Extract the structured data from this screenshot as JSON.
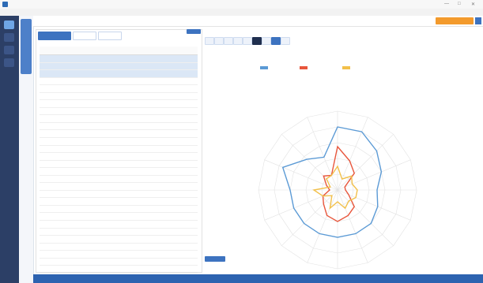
{
  "window": {
    "title": "",
    "controls": [
      "—",
      "□",
      "✕"
    ]
  },
  "menu": {
    "items": [
      "",
      "",
      "",
      ""
    ]
  },
  "header": {
    "breadcrumb": "",
    "action_button": ""
  },
  "left": {
    "tabs": [
      "",
      "",
      ""
    ],
    "columns": [
      "",
      "",
      "",
      "",
      "",
      "",
      ""
    ],
    "rows": [
      {
        "name": "",
        "cells": [
          "",
          "",
          "",
          "",
          "",
          ""
        ],
        "selected": true
      },
      {
        "name": "",
        "cells": [
          "",
          "",
          "",
          "",
          "",
          ""
        ],
        "selected": true
      },
      {
        "name": "",
        "cells": [
          "",
          "",
          "",
          "",
          "",
          ""
        ],
        "selected": true
      },
      {
        "name": "",
        "cells": [
          "",
          "",
          "",
          "",
          "",
          ""
        ]
      },
      {
        "name": "",
        "cells": [
          "",
          "",
          "",
          "",
          "",
          ""
        ]
      },
      {
        "name": "",
        "cells": [
          "",
          "",
          "",
          "",
          "",
          ""
        ]
      },
      {
        "name": "",
        "cells": [
          "",
          "",
          "",
          "",
          "",
          ""
        ]
      },
      {
        "name": "",
        "cells": [
          "",
          "",
          "",
          "",
          "",
          ""
        ]
      },
      {
        "name": "",
        "cells": [
          "",
          "",
          "",
          "",
          "",
          ""
        ]
      },
      {
        "name": "",
        "cells": [
          "",
          "",
          "",
          "",
          "",
          ""
        ]
      },
      {
        "name": "",
        "cells": [
          "",
          "",
          "",
          "",
          "",
          ""
        ]
      },
      {
        "name": "",
        "cells": [
          "",
          "",
          "",
          "",
          "",
          ""
        ]
      },
      {
        "name": "",
        "cells": [
          "",
          "",
          "",
          "",
          "",
          ""
        ]
      },
      {
        "name": "",
        "cells": [
          "",
          "",
          "",
          "",
          "",
          ""
        ]
      },
      {
        "name": "",
        "cells": [
          "",
          "",
          "",
          "",
          "",
          ""
        ]
      },
      {
        "name": "",
        "cells": [
          "",
          "",
          "",
          "",
          "",
          ""
        ]
      },
      {
        "name": "",
        "cells": [
          "",
          "",
          "",
          "",
          "",
          ""
        ]
      },
      {
        "name": "",
        "cells": [
          "",
          "",
          "",
          "",
          "",
          ""
        ]
      },
      {
        "name": "",
        "cells": [
          "",
          "",
          "",
          "",
          "",
          ""
        ]
      },
      {
        "name": "",
        "cells": [
          "",
          "",
          "",
          "",
          "",
          ""
        ]
      },
      {
        "name": "",
        "cells": [
          "",
          "",
          "",
          "",
          "",
          ""
        ]
      },
      {
        "name": "",
        "cells": [
          "",
          "",
          "",
          "",
          "",
          ""
        ]
      },
      {
        "name": "",
        "cells": [
          "",
          "",
          "",
          "",
          "",
          ""
        ]
      },
      {
        "name": "",
        "cells": [
          "",
          "",
          "",
          "",
          "",
          ""
        ]
      },
      {
        "name": "",
        "cells": [
          "",
          "",
          "",
          "",
          "",
          ""
        ]
      },
      {
        "name": "",
        "cells": [
          "",
          "",
          "",
          "",
          "",
          ""
        ]
      },
      {
        "name": "",
        "cells": [
          "",
          "",
          "",
          "",
          "",
          ""
        ]
      },
      {
        "name": "",
        "cells": [
          "",
          "",
          "",
          "",
          "",
          ""
        ]
      },
      {
        "name": "",
        "cells": [
          "",
          "",
          "",
          "",
          "",
          ""
        ]
      },
      {
        "name": "",
        "cells": [
          "",
          "",
          "",
          "",
          "",
          ""
        ]
      }
    ],
    "footer": ""
  },
  "right": {
    "toolbar_buttons": [
      "",
      "",
      "",
      "",
      "",
      "",
      "",
      "",
      ""
    ],
    "toolbar_label": ""
  },
  "chart_data": {
    "type": "radar",
    "title": "",
    "subtitle": "",
    "axes": [
      "",
      "",
      "",
      "",
      "",
      "",
      "",
      "",
      "",
      "",
      "",
      "",
      "",
      "",
      "",
      ""
    ],
    "series": [
      {
        "name": "",
        "color": "#5b9ad5",
        "values": [
          80,
          80,
          70,
          60,
          50,
          55,
          60,
          60,
          60,
          60,
          60,
          60,
          60,
          75,
          55,
          45
        ]
      },
      {
        "name": "",
        "color": "#e8563c",
        "values": [
          55,
          40,
          30,
          10,
          10,
          15,
          30,
          35,
          40,
          35,
          25,
          20,
          10,
          15,
          25,
          20
        ]
      },
      {
        "name": "",
        "color": "#f2c04a",
        "values": [
          30,
          15,
          25,
          20,
          25,
          25,
          20,
          25,
          15,
          25,
          10,
          20,
          30,
          10,
          20,
          20
        ]
      }
    ],
    "rings": 5,
    "max": 100
  },
  "status": {
    "left": "",
    "right1": "",
    "right2": ""
  },
  "pagination": {
    "text1": "",
    "text2": ""
  },
  "colors": {
    "accent": "#3d73c0",
    "rail": "#2c3f66",
    "orange": "#f39a2c",
    "status": "#2d63b0"
  }
}
